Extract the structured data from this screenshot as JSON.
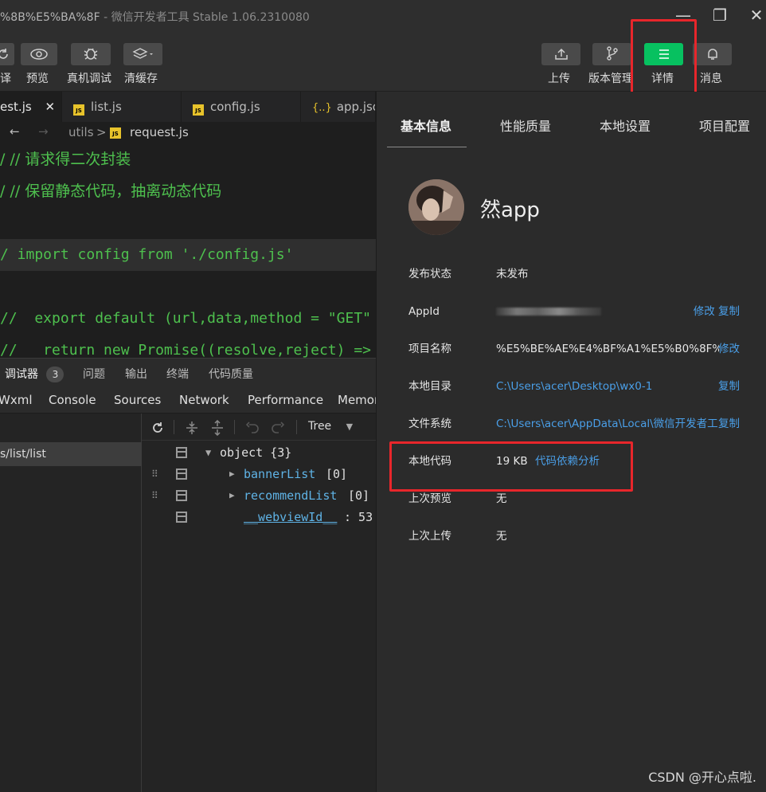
{
  "window": {
    "title_prefix": "%8B%E5%BA%8F",
    "title_suffix": " - 微信开发者工具 Stable 1.06.2310080",
    "minimize": "—",
    "restore": "❐",
    "close": "✕"
  },
  "toolbar": {
    "left_buttons": [
      {
        "label": "译",
        "icon": "refresh-icon"
      },
      {
        "label": "预览",
        "icon": "eye-icon"
      },
      {
        "label": "真机调试",
        "icon": "bug-icon"
      },
      {
        "label": "清缓存",
        "icon": "layers-icon"
      }
    ],
    "right_buttons": [
      {
        "label": "上传",
        "icon": "upload-icon"
      },
      {
        "label": "版本管理",
        "icon": "branch-icon"
      },
      {
        "label": "详情",
        "icon": "menu-icon"
      },
      {
        "label": "消息",
        "icon": "bell-icon"
      }
    ],
    "accent": "#07c160"
  },
  "editor": {
    "tabs": [
      {
        "label": "est.js",
        "close": "✕"
      },
      {
        "label": "list.js"
      },
      {
        "label": "config.js"
      },
      {
        "label": "app.json",
        "icon": "{..}"
      }
    ],
    "breadcrumb": {
      "nav_back": "←",
      "nav_forward": "→",
      "folder": "utils",
      "sep": ">",
      "file": "request.js"
    },
    "code_lines": [
      "/ // 请求得二次封装",
      "/ // 保留静态代码，抽离动态代码",
      "",
      "/ import config from './config.js'",
      "",
      "//  export default (url,data,method = \"GET\"",
      "//   return new Promise((resolve,reject) =>"
    ]
  },
  "devtools": {
    "tabs": [
      {
        "label": "调试器",
        "badge": "3"
      },
      {
        "label": "问题"
      },
      {
        "label": "输出"
      },
      {
        "label": "终端"
      },
      {
        "label": "代码质量"
      }
    ],
    "panels": [
      "Wxml",
      "Console",
      "Sources",
      "Network",
      "Performance",
      "Memor"
    ],
    "page_path": "s/list/list",
    "view_mode": "Tree",
    "tree": {
      "root": "object {3}",
      "items": [
        {
          "key": "bannerList",
          "value": "[0]"
        },
        {
          "key": "recommendList",
          "value": "[0]"
        },
        {
          "key": "__webviewId__",
          "value": ": 53"
        }
      ]
    }
  },
  "details": {
    "tabs": [
      "基本信息",
      "性能质量",
      "本地设置",
      "项目配置"
    ],
    "app_name": "然app",
    "rows": [
      {
        "label": "发布状态",
        "value": "未发布"
      },
      {
        "label": "AppId",
        "value": "",
        "action": "修改 复制"
      },
      {
        "label": "项目名称",
        "value": "%E5%BE%AE%E4%BF%A1%E5%B0%8F%E7...",
        "action": "修改"
      },
      {
        "label": "本地目录",
        "value": "C:\\Users\\acer\\Desktop\\wx0-1",
        "action": "复制"
      },
      {
        "label": "文件系统",
        "value": "C:\\Users\\acer\\AppData\\Local\\微信开发者工...",
        "action": "复制"
      },
      {
        "label": "本地代码",
        "value": "19 KB",
        "link": "代码依赖分析"
      },
      {
        "label": "上次预览",
        "value": "无"
      },
      {
        "label": "上次上传",
        "value": "无"
      }
    ]
  },
  "watermark": "CSDN @开心点啦."
}
